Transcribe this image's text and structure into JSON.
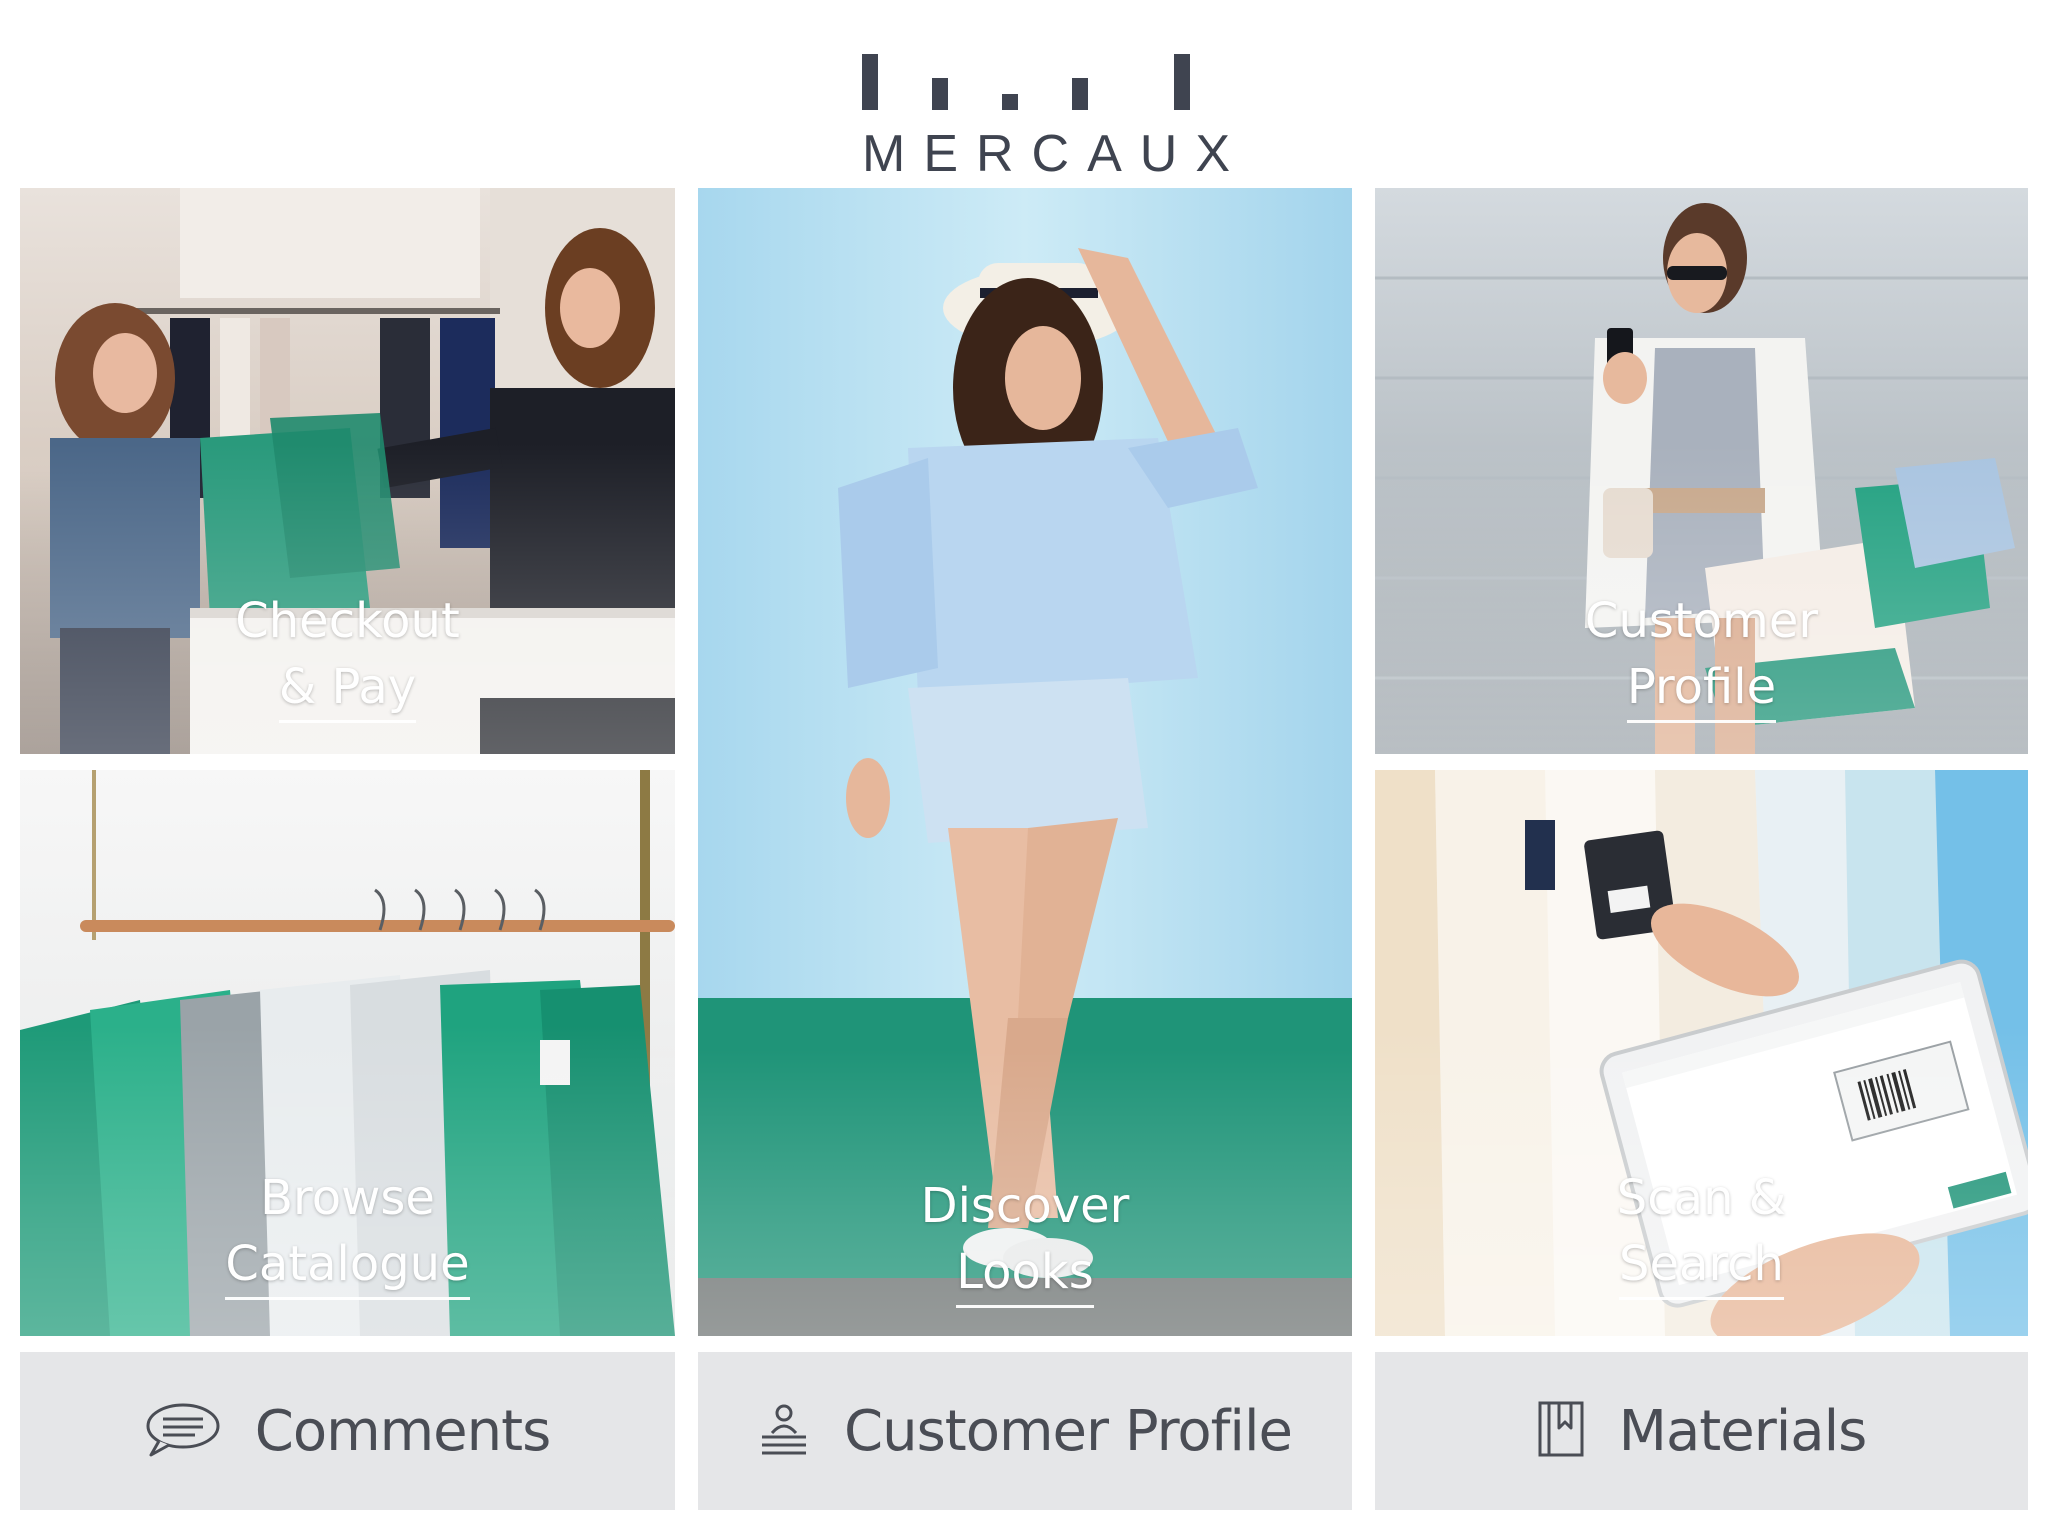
{
  "brand": {
    "name": "MERCAUX"
  },
  "tiles": [
    {
      "id": "checkout",
      "line1": "Checkout",
      "line2": "& Pay"
    },
    {
      "id": "browse",
      "line1": "Browse",
      "line2": "Catalogue"
    },
    {
      "id": "discover",
      "line1": "Discover",
      "line2": "Looks"
    },
    {
      "id": "customer",
      "line1": "Customer",
      "line2": "Profile"
    },
    {
      "id": "scan",
      "line1": "Scan &",
      "line2": "Search"
    }
  ],
  "bottom_bar": {
    "comments": {
      "label": "Comments",
      "icon": "speech-bubble-icon"
    },
    "profile": {
      "label": "Customer Profile",
      "icon": "person-stack-icon"
    },
    "materials": {
      "label": "Materials",
      "icon": "bookmark-book-icon"
    }
  },
  "colors": {
    "brand_dark": "#3f4450",
    "button_bg": "#e5e6e8",
    "button_text": "#4a4d55",
    "accent_green": "#1f9478",
    "sky_blue": "#a9d9ef"
  }
}
